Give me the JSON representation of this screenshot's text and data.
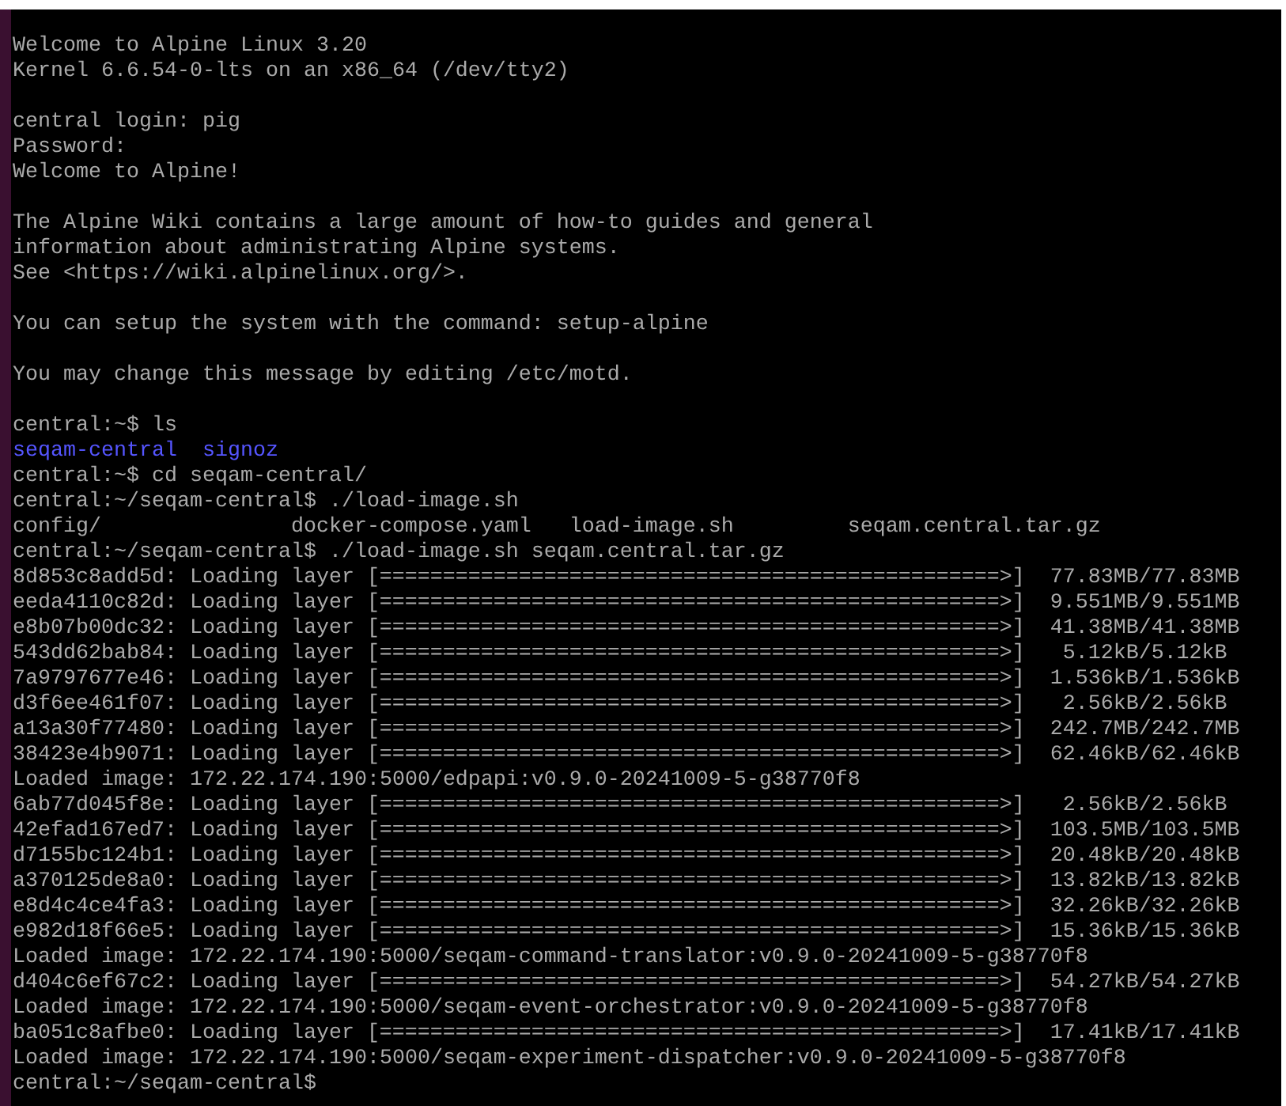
{
  "terminal": {
    "lines": [
      {
        "kind": "text",
        "text": "Welcome to Alpine Linux 3.20"
      },
      {
        "kind": "text",
        "text": "Kernel 6.6.54-0-lts on an x86_64 (/dev/tty2)"
      },
      {
        "kind": "blank"
      },
      {
        "kind": "text",
        "text": "central login: pig"
      },
      {
        "kind": "text",
        "text": "Password:"
      },
      {
        "kind": "text",
        "text": "Welcome to Alpine!"
      },
      {
        "kind": "blank"
      },
      {
        "kind": "text",
        "text": "The Alpine Wiki contains a large amount of how-to guides and general"
      },
      {
        "kind": "text",
        "text": "information about administrating Alpine systems."
      },
      {
        "kind": "text",
        "text": "See <https://wiki.alpinelinux.org/>."
      },
      {
        "kind": "blank"
      },
      {
        "kind": "text",
        "text": "You can setup the system with the command: setup-alpine"
      },
      {
        "kind": "blank"
      },
      {
        "kind": "text",
        "text": "You may change this message by editing /etc/motd."
      },
      {
        "kind": "blank"
      },
      {
        "kind": "prompt",
        "prompt": "central:~$",
        "command": "ls"
      },
      {
        "kind": "ls-output",
        "entries": [
          {
            "name": "seqam-central",
            "highlighted": true
          },
          {
            "name": "signoz",
            "highlighted": true
          }
        ]
      },
      {
        "kind": "prompt",
        "prompt": "central:~$",
        "command": "cd seqam-central/"
      },
      {
        "kind": "prompt",
        "prompt": "central:~/seqam-central$",
        "command": "./load-image.sh"
      },
      {
        "kind": "completion-list",
        "entries": [
          {
            "name": "config/",
            "highlighted": false
          },
          {
            "name": "docker-compose.yaml",
            "highlighted": false
          },
          {
            "name": "load-image.sh",
            "highlighted": false
          },
          {
            "name": "seqam.central.tar.gz",
            "highlighted": false
          }
        ]
      },
      {
        "kind": "prompt",
        "prompt": "central:~/seqam-central$",
        "command": "./load-image.sh seqam.central.tar.gz"
      },
      {
        "kind": "layer",
        "id": "8d853c8add5d:",
        "label": "Loading layer",
        "bar": "[=================================================>]",
        "size": "77.83MB/77.83MB"
      },
      {
        "kind": "layer",
        "id": "eeda4110c82d:",
        "label": "Loading layer",
        "bar": "[=================================================>]",
        "size": "9.551MB/9.551MB"
      },
      {
        "kind": "layer",
        "id": "e8b07b00dc32:",
        "label": "Loading layer",
        "bar": "[=================================================>]",
        "size": "41.38MB/41.38MB"
      },
      {
        "kind": "layer",
        "id": "543dd62bab84:",
        "label": "Loading layer",
        "bar": "[=================================================>]",
        "size": "5.12kB/5.12kB"
      },
      {
        "kind": "layer",
        "id": "7a9797677e46:",
        "label": "Loading layer",
        "bar": "[=================================================>]",
        "size": "1.536kB/1.536kB"
      },
      {
        "kind": "layer",
        "id": "d3f6ee461f07:",
        "label": "Loading layer",
        "bar": "[=================================================>]",
        "size": "2.56kB/2.56kB"
      },
      {
        "kind": "layer",
        "id": "a13a30f77480:",
        "label": "Loading layer",
        "bar": "[=================================================>]",
        "size": "242.7MB/242.7MB"
      },
      {
        "kind": "layer",
        "id": "38423e4b9071:",
        "label": "Loading layer",
        "bar": "[=================================================>]",
        "size": "62.46kB/62.46kB"
      },
      {
        "kind": "text",
        "text": "Loaded image: 172.22.174.190:5000/edpapi:v0.9.0-20241009-5-g38770f8"
      },
      {
        "kind": "layer",
        "id": "6ab77d045f8e:",
        "label": "Loading layer",
        "bar": "[=================================================>]",
        "size": "2.56kB/2.56kB"
      },
      {
        "kind": "layer",
        "id": "42efad167ed7:",
        "label": "Loading layer",
        "bar": "[=================================================>]",
        "size": "103.5MB/103.5MB"
      },
      {
        "kind": "layer",
        "id": "d7155bc124b1:",
        "label": "Loading layer",
        "bar": "[=================================================>]",
        "size": "20.48kB/20.48kB"
      },
      {
        "kind": "layer",
        "id": "a370125de8a0:",
        "label": "Loading layer",
        "bar": "[=================================================>]",
        "size": "13.82kB/13.82kB"
      },
      {
        "kind": "layer",
        "id": "e8d4c4ce4fa3:",
        "label": "Loading layer",
        "bar": "[=================================================>]",
        "size": "32.26kB/32.26kB"
      },
      {
        "kind": "layer",
        "id": "e982d18f66e5:",
        "label": "Loading layer",
        "bar": "[=================================================>]",
        "size": "15.36kB/15.36kB"
      },
      {
        "kind": "text",
        "text": "Loaded image: 172.22.174.190:5000/seqam-command-translator:v0.9.0-20241009-5-g38770f8"
      },
      {
        "kind": "layer",
        "id": "d404c6ef67c2:",
        "label": "Loading layer",
        "bar": "[=================================================>]",
        "size": "54.27kB/54.27kB"
      },
      {
        "kind": "text",
        "text": "Loaded image: 172.22.174.190:5000/seqam-event-orchestrator:v0.9.0-20241009-5-g38770f8"
      },
      {
        "kind": "layer",
        "id": "ba051c8afbe0:",
        "label": "Loading layer",
        "bar": "[=================================================>]",
        "size": "17.41kB/17.41kB"
      },
      {
        "kind": "text",
        "text": "Loaded image: 172.22.174.190:5000/seqam-experiment-dispatcher:v0.9.0-20241009-5-g38770f8"
      },
      {
        "kind": "prompt",
        "prompt": "central:~/seqam-central$"
      }
    ]
  }
}
